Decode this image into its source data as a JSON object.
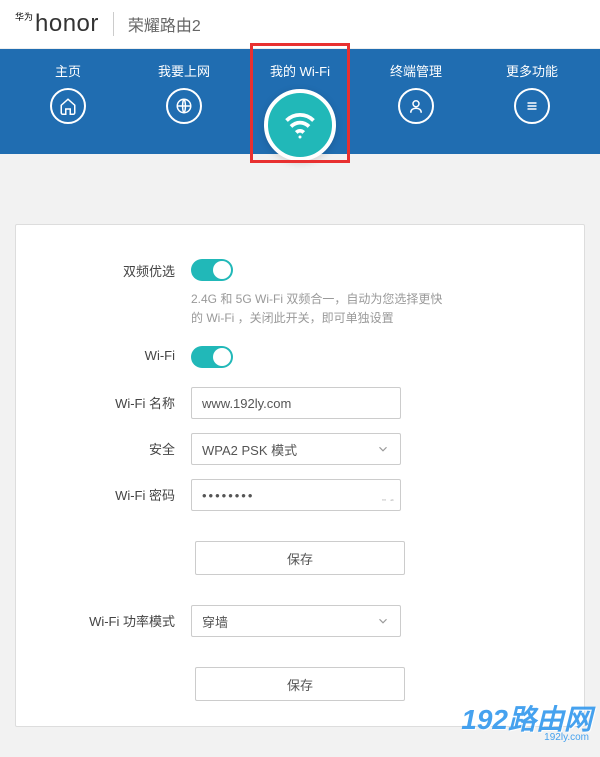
{
  "header": {
    "brand_prefix": "华为",
    "brand": "honor",
    "product": "荣耀路由2"
  },
  "nav": {
    "items": [
      {
        "label": "主页"
      },
      {
        "label": "我要上网"
      },
      {
        "label": "我的 Wi-Fi"
      },
      {
        "label": "终端管理"
      },
      {
        "label": "更多功能"
      }
    ]
  },
  "wifi": {
    "dual_band_label": "双频优选",
    "dual_band_on": true,
    "dual_band_help": "2.4G 和 5G Wi-Fi 双频合一，自动为您选择更快的 Wi-Fi ，关闭此开关，即可单独设置",
    "wifi_switch_label": "Wi-Fi",
    "wifi_on": true,
    "name_label": "Wi-Fi 名称",
    "name_value": "www.192ly.com",
    "security_label": "安全",
    "security_value": "WPA2 PSK 模式",
    "password_label": "Wi-Fi 密码",
    "password_value": "••••••••",
    "save_label": "保存",
    "power_label": "Wi-Fi 功率模式",
    "power_value": "穿墙",
    "save2_label": "保存"
  },
  "watermark": {
    "text": "192路由网",
    "url": "192ly.com"
  }
}
